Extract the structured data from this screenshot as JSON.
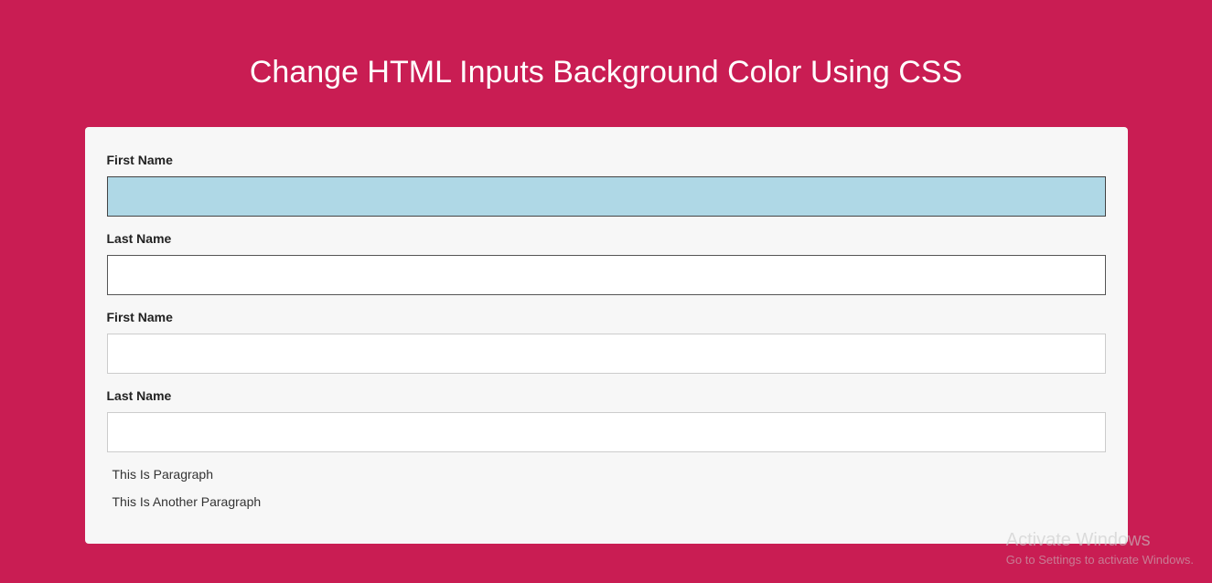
{
  "page": {
    "title": "Change HTML Inputs Background Color Using CSS"
  },
  "form": {
    "fields": [
      {
        "label": "First Name",
        "value": ""
      },
      {
        "label": "Last Name",
        "value": ""
      },
      {
        "label": "First Name",
        "value": ""
      },
      {
        "label": "Last Name",
        "value": ""
      }
    ],
    "paragraphs": [
      "This Is Paragraph",
      "This Is Another Paragraph"
    ]
  },
  "watermark": {
    "title": "Activate Windows",
    "subtitle": "Go to Settings to activate Windows."
  }
}
